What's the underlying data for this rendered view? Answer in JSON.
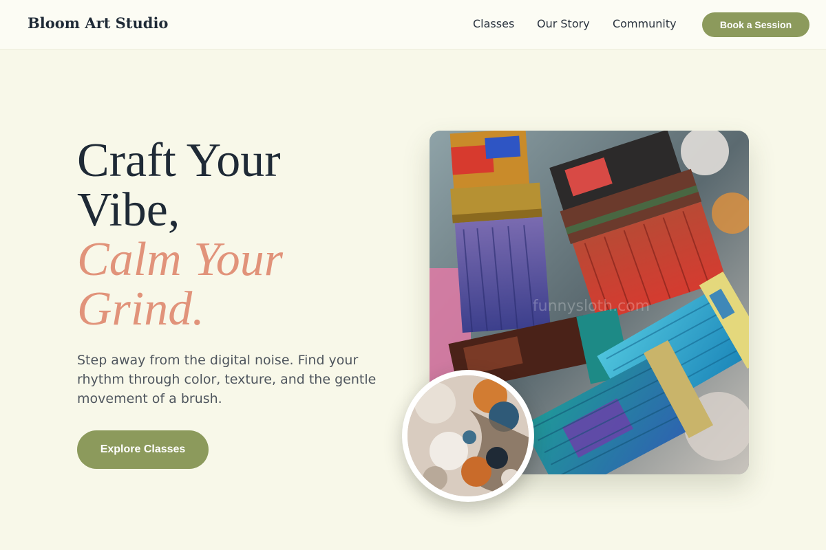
{
  "header": {
    "brand": "Bloom Art Studio",
    "nav": [
      "Classes",
      "Our Story",
      "Community"
    ],
    "cta_label": "Book a Session"
  },
  "hero": {
    "title_line1": "Craft Your",
    "title_line2": "Vibe,",
    "title_accent_line1": "Calm Your",
    "title_accent_line2": "Grind.",
    "description": "Step away from the digital noise. Find your rhythm through color, texture, and the gentle movement of a brush.",
    "cta_label": "Explore Classes",
    "main_image_watermark": "funnysloth.com"
  },
  "colors": {
    "background": "#f8f8e9",
    "primary": "#8c9a5c",
    "accent": "#e1937a",
    "heading": "#1f2a36"
  }
}
